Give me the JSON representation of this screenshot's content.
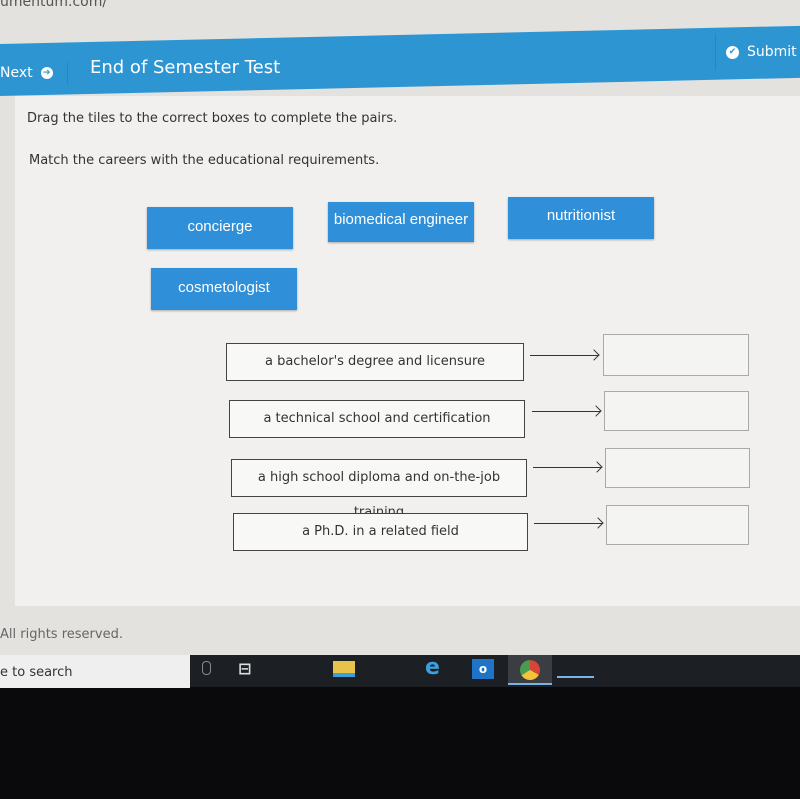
{
  "browser": {
    "url": "umentum.com/"
  },
  "header": {
    "next_label": "Next",
    "title": "End of Semester Test",
    "submit_label": "Submit",
    "accent": "#2e95d3"
  },
  "question": {
    "instruction": "Drag the tiles to the correct boxes to complete the pairs.",
    "prompt": "Match the careers with the educational requirements."
  },
  "tiles": [
    "concierge",
    "biomedical engineer",
    "nutritionist",
    "cosmetologist"
  ],
  "requirements": [
    "a bachelor's degree and licensure",
    "a technical school and certification",
    "a high school diploma and on-the-job training",
    "a Ph.D. in a related field"
  ],
  "footer": {
    "text": "All rights reserved."
  },
  "taskbar": {
    "search_placeholder": "e to search",
    "icons": [
      "microphone-icon",
      "task-view-icon",
      "file-explorer-icon",
      "internet-explorer-icon",
      "outlook-icon",
      "chrome-icon"
    ]
  }
}
